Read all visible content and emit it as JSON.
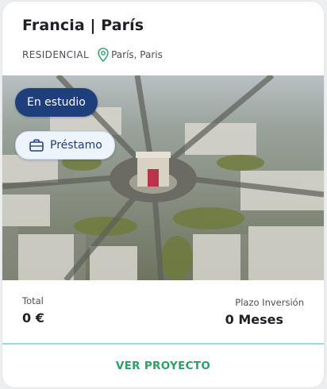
{
  "card": {
    "title": "Francia | París",
    "type": "RESIDENCIAL",
    "location": "París, Paris",
    "badges": {
      "status": "En estudio",
      "loan": "Préstamo"
    },
    "stats": {
      "total_label": "Total",
      "total_value": "0 €",
      "term_label": "Plazo Inversión",
      "term_value": "0 Meses"
    },
    "cta_label": "VER PROYECTO"
  },
  "icons": {
    "location": "map-pin-icon",
    "loan": "briefcase-icon"
  },
  "colors": {
    "status_badge_bg": "#1f3f7c",
    "loan_badge_bg": "#eef4fb",
    "accent_green": "#2e9e67",
    "divider": "#8fe3d1",
    "pin": "#3aa776"
  }
}
